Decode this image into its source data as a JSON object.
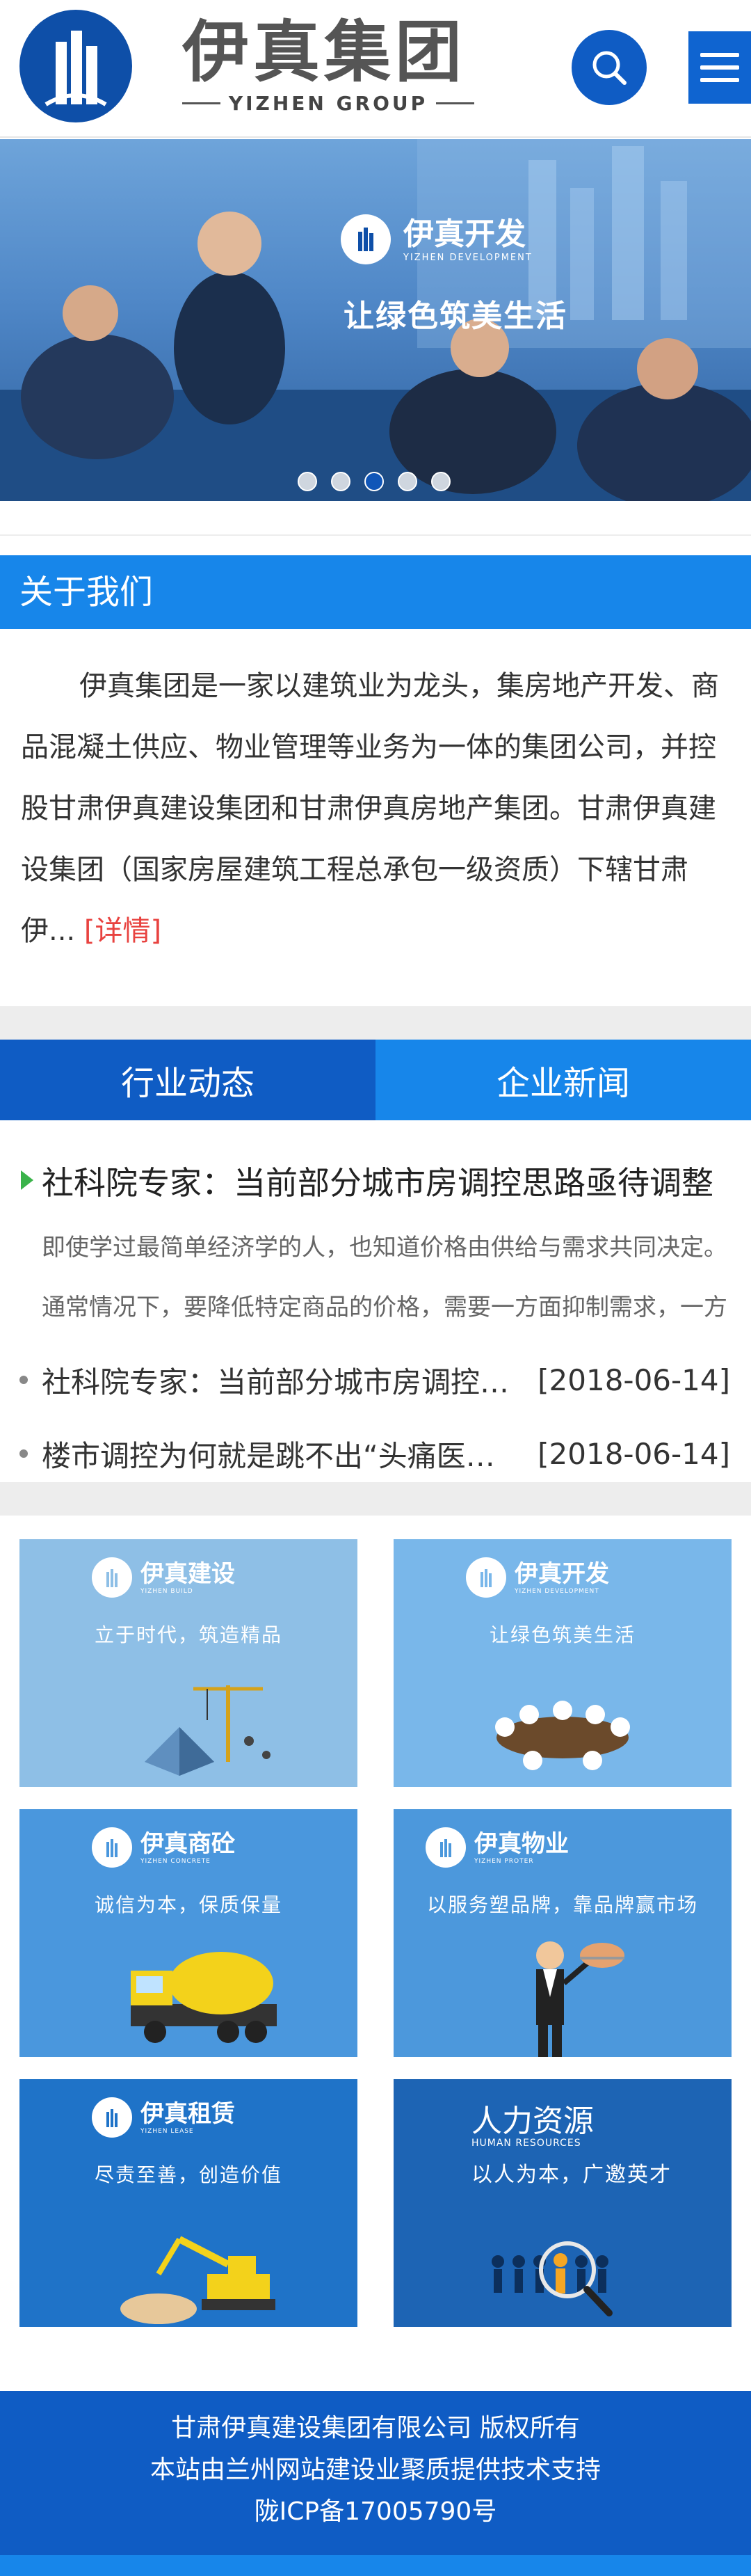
{
  "header": {
    "brand_cn": "伊真集团",
    "brand_en": "YIZHEN GROUP",
    "logo_icon": "building-logo-icon",
    "search_icon": "search-icon",
    "menu_icon": "hamburger-menu-icon"
  },
  "banner": {
    "brand_cn": "伊真开发",
    "brand_en": "YIZHEN DEVELOPMENT",
    "slogan": "让绿色筑美生活",
    "slides": 5,
    "active_slide": 3
  },
  "about": {
    "title": "关于我们",
    "text": "伊真集团是一家以建筑业为龙头，集房地产开发、商品混凝土供应、物业管理等业务为一体的集团公司，并控股甘肃伊真建设集团和甘肃伊真房地产集团。甘肃伊真建设集团（国家房屋建筑工程总承包一级资质）下辖甘肃伊...",
    "more": "[详情]"
  },
  "news": {
    "tabs": [
      "行业动态",
      "企业新闻"
    ],
    "feature_title": "社科院专家：当前部分城市房调控思路亟待调整",
    "feature_desc": "即使学过最简单经济学的人，也知道价格由供给与需求共同决定。通常情况下，要降低特定商品的价格，需要一方面抑制需求，一方面增加供给。",
    "items": [
      {
        "title": "社科院专家：当前部分城市房调控思路亟待调整",
        "date": "[2018-06-14]"
      },
      {
        "title": "楼市调控为何就是跳不出“头痛医头、脚痛医脚”",
        "date": "[2018-06-14]"
      }
    ]
  },
  "tiles": [
    {
      "cn": "伊真建设",
      "en": "YIZHEN BUILD",
      "sub": "立于时代，筑造精品",
      "color": "#8ebfe6",
      "icon": "crane-icon"
    },
    {
      "cn": "伊真开发",
      "en": "YIZHEN DEVELOPMENT",
      "sub": "让绿色筑美生活",
      "color": "#79b7ea",
      "icon": "meeting-table-icon"
    },
    {
      "cn": "伊真商砼",
      "en": "YIZHEN CONCRETE",
      "sub": "诚信为本，保质保量",
      "color": "#4a97dd",
      "icon": "mixer-truck-icon"
    },
    {
      "cn": "伊真物业",
      "en": "YIZHEN PROTER",
      "sub": "以服务塑品牌，靠品牌赢市场",
      "color": "#4c98dc",
      "icon": "waiter-icon"
    },
    {
      "cn": "伊真租赁",
      "en": "YIZHEN LEASE",
      "sub": "尽责至善，创造价值",
      "color": "#1f73c8",
      "icon": "excavator-icon"
    },
    {
      "cn": "人力资源",
      "en": "HUMAN RESOURCES",
      "sub": "以人为本，广邀英才",
      "color": "#1d64b4",
      "icon": "magnifier-people-icon"
    }
  ],
  "footer": {
    "line1": "甘肃伊真建设集团有限公司 版权所有",
    "line2": "本站由兰州网站建设业聚质提供技术支持",
    "line3": "陇ICP备17005790号"
  }
}
